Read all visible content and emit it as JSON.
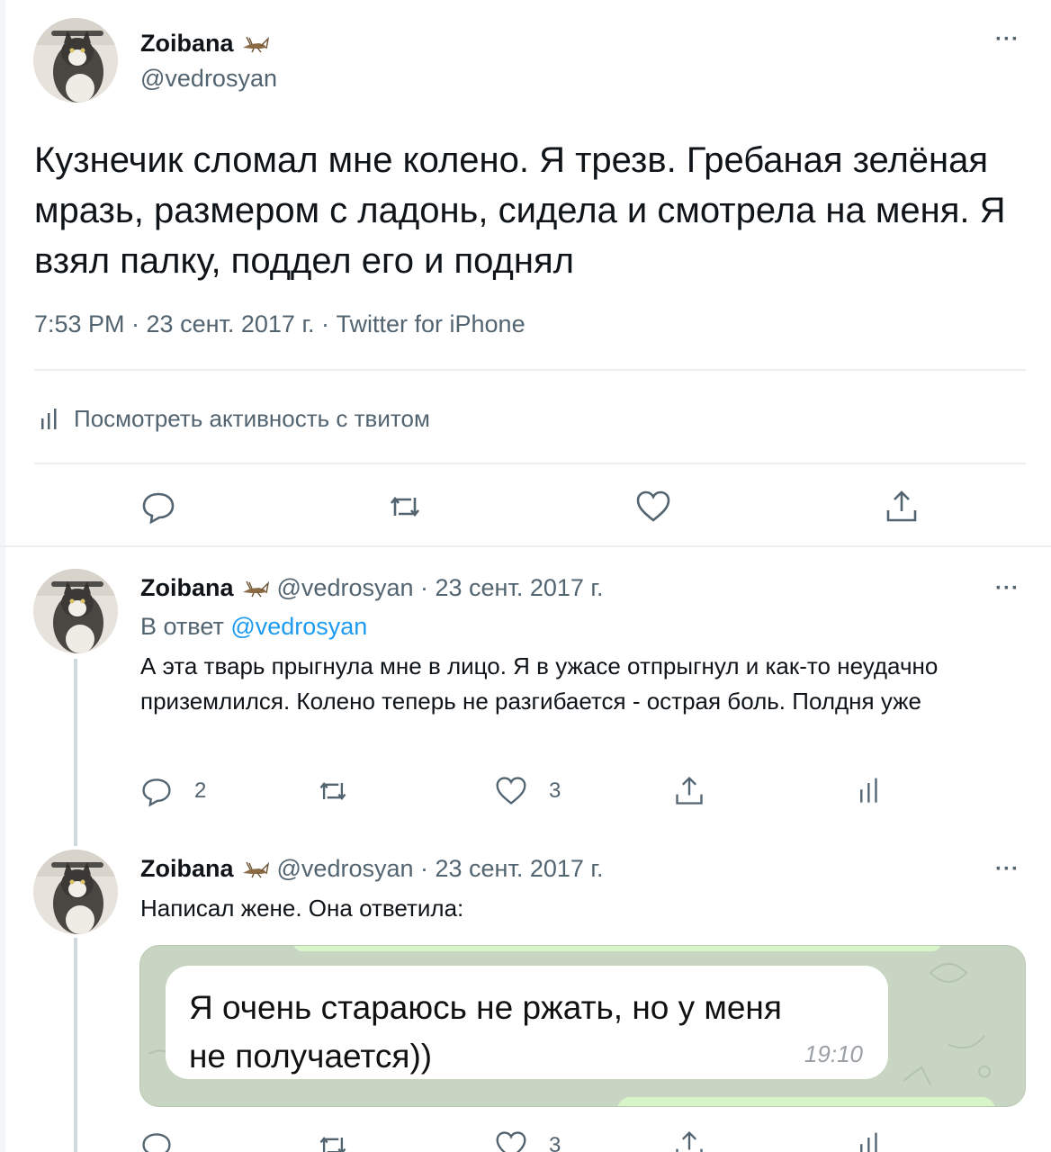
{
  "main_tweet": {
    "name": "Zoibana",
    "handle": "@vedrosyan",
    "more": "···",
    "text": "Кузнечик сломал мне колено. Я трезв. Гребаная зелёная мразь, размером с ладонь, сидела и смотрела на меня. Я взял палку, поддел его и поднял",
    "meta": "7:53 PM · 23 сент. 2017 г. · Twitter for iPhone",
    "analytics_label": "Посмотреть активность с твитом",
    "actions": {
      "reply_icon": "reply-icon",
      "retweet_icon": "retweet-icon",
      "like_icon": "heart-icon",
      "share_icon": "share-icon"
    }
  },
  "replies": [
    {
      "name": "Zoibana",
      "handle_date": "@vedrosyan · 23 сент. 2017 г.",
      "more": "···",
      "reply_to_prefix": "В ответ",
      "reply_to_handle": "@vedrosyan",
      "text": "А эта тварь прыгнула мне в лицо. Я в ужасе отпрыгнул и как-то неудачно приземлился. Колено теперь не разгибается - острая боль. Полдня уже",
      "reply_count": "2",
      "like_count": "3"
    },
    {
      "name": "Zoibana",
      "handle_date": "@vedrosyan · 23 сент. 2017 г.",
      "more": "···",
      "text": "Написал жене. Она ответила:",
      "media": {
        "message": "Я очень стараюсь не ржать, но у меня не получается))",
        "time": "19:10"
      },
      "like_count": "3"
    }
  ],
  "colors": {
    "text": "#0f1419",
    "secondary": "#536471",
    "link": "#1d9bf0",
    "divider": "#eceff1"
  }
}
